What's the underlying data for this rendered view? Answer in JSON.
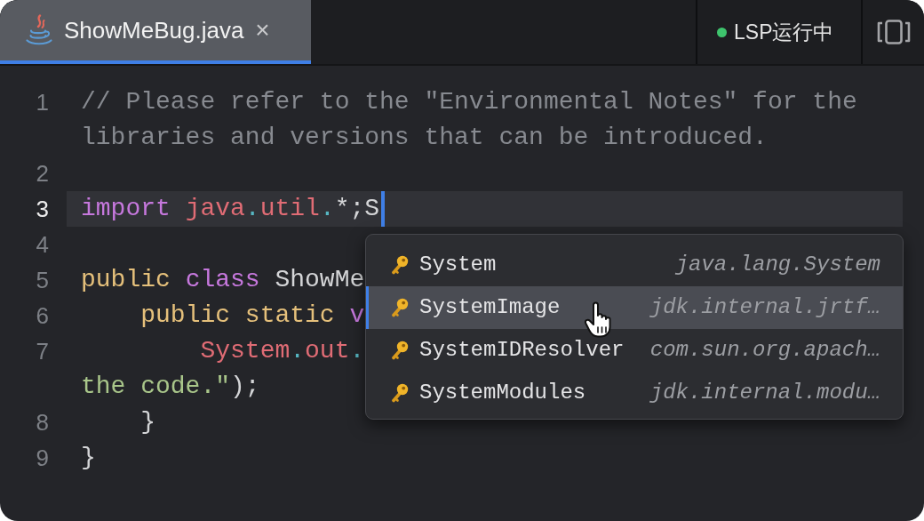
{
  "tabs": [
    {
      "label": "ShowMeBug.java",
      "close": "×",
      "selected": true
    }
  ],
  "status": {
    "label": "LSP运行中",
    "running": true
  },
  "editor": {
    "lines": [
      {
        "number": "1",
        "current": false,
        "rows": [
          {
            "tokens": [
              {
                "kind": "comment",
                "text": "// Please refer to the \"Environmental Notes\" for the"
              }
            ]
          },
          {
            "tokens": [
              {
                "kind": "comment",
                "text": "libraries and versions that can be introduced."
              }
            ]
          }
        ]
      },
      {
        "number": "2",
        "current": false
      },
      {
        "number": "3",
        "current": true,
        "rows": [
          {
            "tokens": [
              {
                "kind": "keyword",
                "text": "import "
              },
              {
                "kind": "name",
                "text": "java"
              },
              {
                "kind": "dot",
                "text": "."
              },
              {
                "kind": "name",
                "text": "util"
              },
              {
                "kind": "dot",
                "text": "."
              },
              {
                "kind": "plain",
                "text": "*;S"
              }
            ]
          }
        ]
      },
      {
        "number": "4",
        "current": false
      },
      {
        "number": "5",
        "current": false,
        "rows": [
          {
            "tokens": [
              {
                "kind": "modifier",
                "text": "public "
              },
              {
                "kind": "keyword",
                "text": "class "
              },
              {
                "kind": "plain",
                "text": "ShowMe"
              }
            ]
          }
        ]
      },
      {
        "number": "6",
        "current": false,
        "rows": [
          {
            "tokens": [
              {
                "kind": "modifier",
                "text": "    public static "
              },
              {
                "kind": "keyword",
                "text": "v"
              }
            ]
          }
        ]
      },
      {
        "number": "7",
        "current": false,
        "rows": [
          {
            "tokens": [
              {
                "kind": "name",
                "text": "        System"
              },
              {
                "kind": "dot",
                "text": "."
              },
              {
                "kind": "name",
                "text": "out"
              },
              {
                "kind": "dot",
                "text": "."
              }
            ]
          },
          {
            "tokens": [
              {
                "kind": "string",
                "text": "the code.\""
              },
              {
                "kind": "plain",
                "text": ");"
              }
            ]
          }
        ]
      },
      {
        "number": "8",
        "current": false,
        "rows": [
          {
            "tokens": [
              {
                "kind": "plain",
                "text": "    }"
              }
            ]
          }
        ]
      },
      {
        "number": "9",
        "current": false,
        "rows": [
          {
            "tokens": [
              {
                "kind": "plain",
                "text": "}"
              }
            ]
          }
        ]
      }
    ]
  },
  "completion": {
    "items": [
      {
        "label": "System",
        "detail": "java.lang.System",
        "selected": false
      },
      {
        "label": "SystemImage",
        "detail": "jdk.internal.jrtf…",
        "selected": true
      },
      {
        "label": "SystemIDResolver",
        "detail": "com.sun.org.apach…",
        "selected": false
      },
      {
        "label": "SystemModules",
        "detail": "jdk.internal.modu…",
        "selected": false
      }
    ]
  }
}
